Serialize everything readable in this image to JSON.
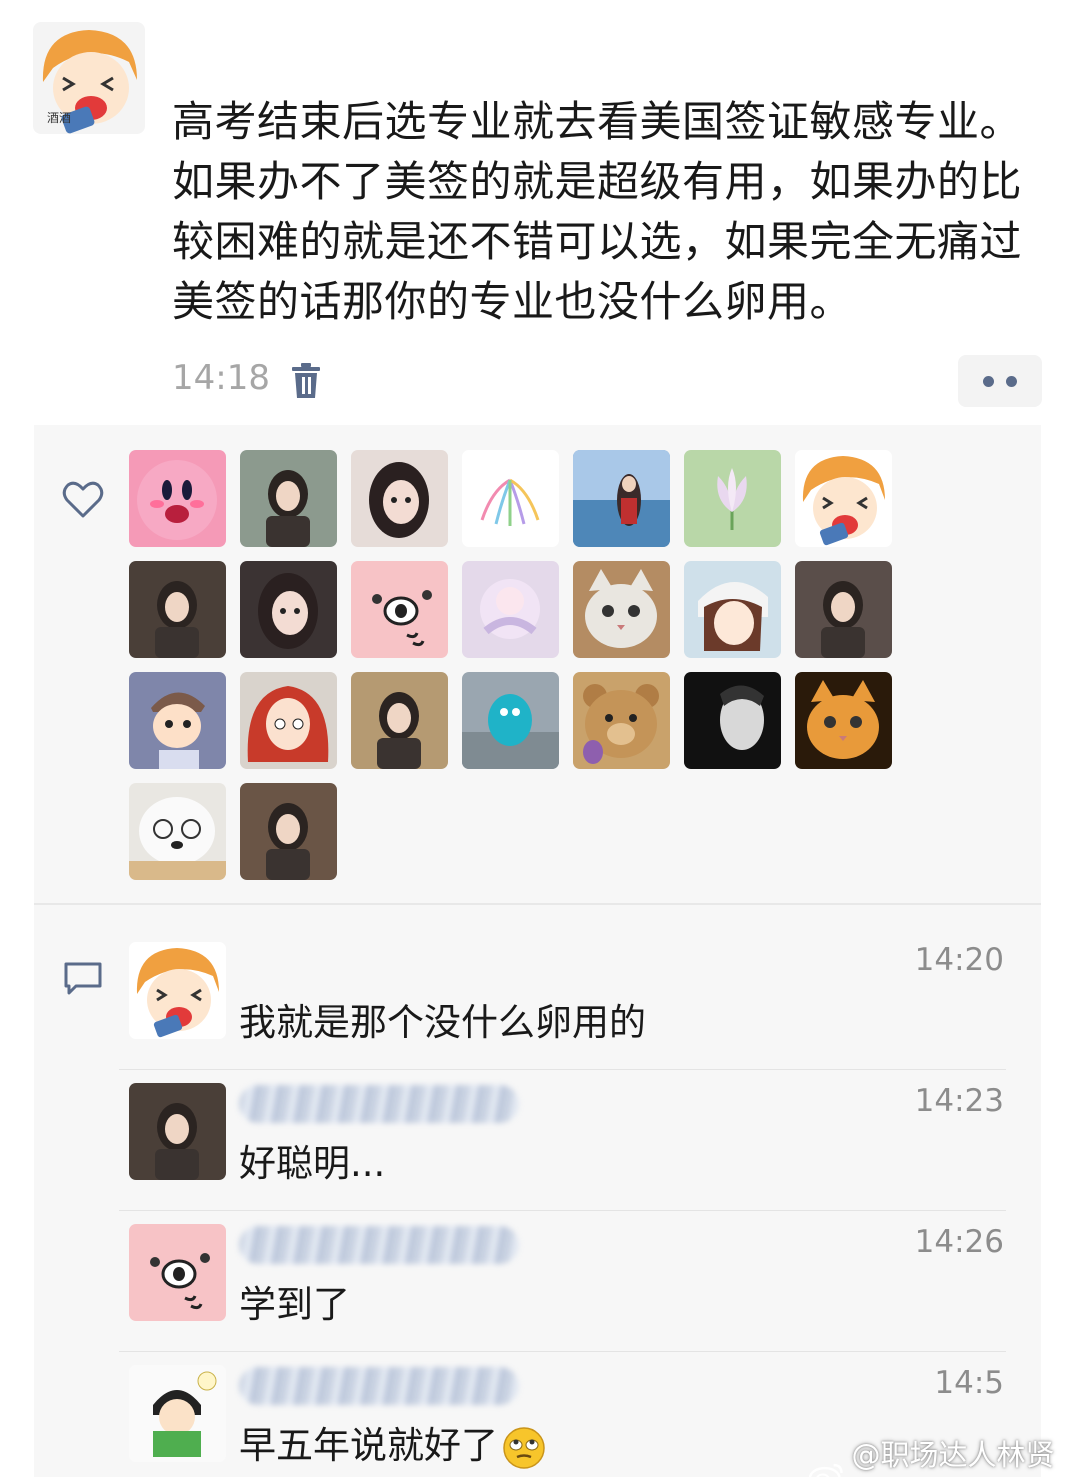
{
  "post": {
    "text": "高考结束后选专业就去看美国签证敏感专业。如果办不了美签的就是超级有用，如果办的比较困难的就是还不错可以选，如果完全无痛过美签的话那你的专业也没什么卵用。",
    "time": "14:18",
    "author_avatar_icon": "cartoon-girl-avatar",
    "delete_icon": "trash-icon",
    "more_icon": "more-dots-icon"
  },
  "likes": {
    "icon": "heart-icon",
    "avatars": [
      {
        "icon": "kirby-avatar",
        "bg": "#f59ab7"
      },
      {
        "icon": "photo-avatar",
        "bg": "#8c9a8e"
      },
      {
        "icon": "girl-photo-avatar",
        "bg": "#e6dcd8"
      },
      {
        "icon": "fireworks-avatar",
        "bg": "#ffffff"
      },
      {
        "icon": "seaside-photo-avatar",
        "bg": "#7da6cf"
      },
      {
        "icon": "lotus-avatar",
        "bg": "#b9d7a8"
      },
      {
        "icon": "cartoon-girl-avatar",
        "bg": "#ffffff"
      },
      {
        "icon": "photo-avatar",
        "bg": "#4a3f38"
      },
      {
        "icon": "girl-photo-avatar",
        "bg": "#3b3333"
      },
      {
        "icon": "pig-avatar",
        "bg": "#f7c3c6"
      },
      {
        "icon": "anime-avatar",
        "bg": "#e4d9ea"
      },
      {
        "icon": "cat-avatar",
        "bg": "#b48c63"
      },
      {
        "icon": "anime-girl-avatar",
        "bg": "#cfe0ea"
      },
      {
        "icon": "photo-avatar",
        "bg": "#5a4e4a"
      },
      {
        "icon": "cartoon-boy-avatar",
        "bg": "#7f86aa"
      },
      {
        "icon": "red-hair-avatar",
        "bg": "#d9d3cc"
      },
      {
        "icon": "photo-avatar",
        "bg": "#b59a72"
      },
      {
        "icon": "toy-avatar",
        "bg": "#9aa6b0"
      },
      {
        "icon": "bear-avatar",
        "bg": "#c9a26b"
      },
      {
        "icon": "bw-photo-avatar",
        "bg": "#111111"
      },
      {
        "icon": "orange-cat-avatar",
        "bg": "#2a1a0a"
      },
      {
        "icon": "dog-avatar",
        "bg": "#e9e7e2"
      },
      {
        "icon": "photo-avatar",
        "bg": "#6a5546"
      }
    ]
  },
  "comments": {
    "icon": "comment-icon",
    "items": [
      {
        "time": "14:20",
        "text": "我就是那个没什么卵用的",
        "avatar": "cartoon-girl-avatar"
      },
      {
        "time": "14:23",
        "text": "好聪明...",
        "avatar": "photo-avatar"
      },
      {
        "time": "14:26",
        "text": "学到了",
        "avatar": "pig-avatar"
      },
      {
        "time": "14:5",
        "text": "早五年说就好了",
        "avatar": "reading-girl-avatar",
        "emoji": "eye-roll-emoji"
      }
    ]
  },
  "watermark": {
    "text": "@职场达人林贤风",
    "icon": "weibo-icon"
  },
  "colors": {
    "link_blue": "#5a6b8a",
    "panel_bg": "#f7f7f7",
    "time_gray": "#a6a6a6"
  }
}
